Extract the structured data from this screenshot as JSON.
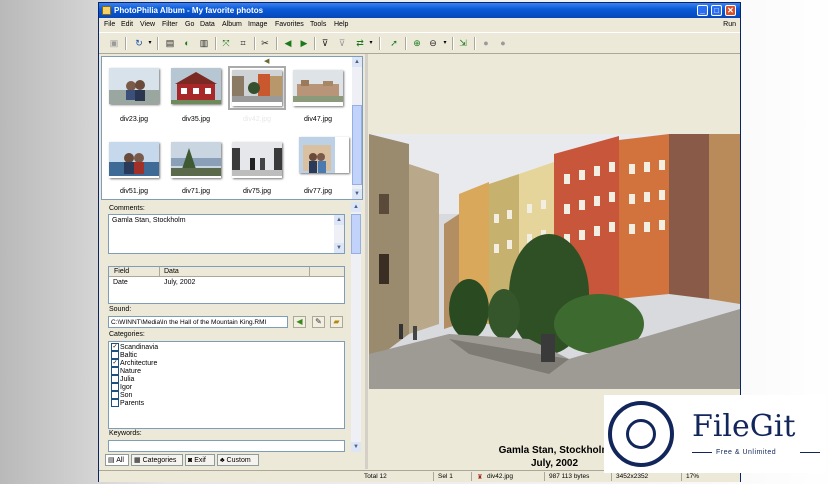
{
  "window": {
    "title": "PhotoPhilia Album - My favorite photos"
  },
  "menu": {
    "items": [
      "File",
      "Edit",
      "View",
      "Filter",
      "Go",
      "Data",
      "Album",
      "Image",
      "Favorites",
      "Tools",
      "Help"
    ],
    "run_label": "Run"
  },
  "toolbar": {
    "icons": [
      "save-icon",
      "refresh-icon",
      "album-icon",
      "open-icon",
      "pages-icon",
      "fit-icon",
      "crop-icon",
      "cut-icon",
      "back-icon",
      "forward-icon",
      "filter-icon",
      "filter-clear-icon",
      "shuffle-icon",
      "pointer-icon",
      "zoom-in-icon",
      "zoom-out-icon",
      "export-icon",
      "record-icon",
      "stop-icon"
    ]
  },
  "thumbnails": [
    {
      "name": "div23.jpg"
    },
    {
      "name": "div35.jpg"
    },
    {
      "name": "div42.jpg"
    },
    {
      "name": "div47.jpg"
    },
    {
      "name": "div51.jpg"
    },
    {
      "name": "div71.jpg"
    },
    {
      "name": "div75.jpg"
    },
    {
      "name": "div77.jpg"
    }
  ],
  "comments": {
    "label": "Comments:",
    "value": "Gamla Stan, Stockholm"
  },
  "fields": {
    "headers": [
      "Field",
      "Data"
    ],
    "rows": [
      {
        "field": "Date",
        "data": "July, 2002"
      }
    ]
  },
  "sound": {
    "label": "Sound:",
    "path": "C:\\WINNT\\Media\\In the Hall of the Mountain King.RMI"
  },
  "categories": {
    "label": "Categories:",
    "items": [
      {
        "name": "Scandinavia",
        "checked": true
      },
      {
        "name": "Baltic",
        "checked": false
      },
      {
        "name": "Architecture",
        "checked": true
      },
      {
        "name": "Nature",
        "checked": false
      },
      {
        "name": "Julia",
        "checked": false
      },
      {
        "name": "Igor",
        "checked": false
      },
      {
        "name": "Son",
        "checked": false
      },
      {
        "name": "Parents",
        "checked": false
      }
    ]
  },
  "keywords": {
    "label": "Keywords:",
    "value": ""
  },
  "tabs": [
    "All",
    "Categories",
    "Exif",
    "Custom"
  ],
  "preview": {
    "caption_line1": "Gamla Stan, Stockholm",
    "caption_line2": "July, 2002"
  },
  "status": {
    "total": "Total 12",
    "sel": "Sel 1",
    "file": "div42.jpg",
    "size": "987 113 bytes",
    "extra": "3452x2352",
    "zoom": "17%"
  },
  "watermark": {
    "title": "FileGit",
    "subtitle": "Free & Unlimited"
  },
  "colors": {
    "titlebar": "#0a5bd8",
    "chrome": "#ece9d8",
    "brand": "#12265c"
  }
}
